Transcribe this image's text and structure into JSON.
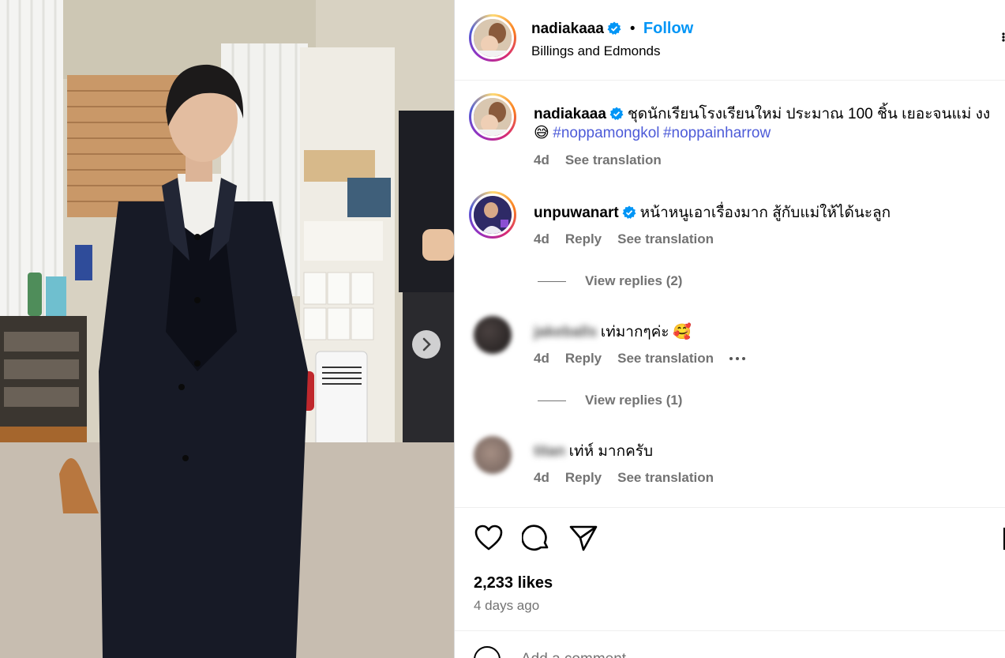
{
  "post": {
    "username": "nadiakaaa",
    "follow_label": "Follow",
    "separator": "•",
    "location": "Billings and Edmonds",
    "caption": {
      "username": "nadiakaaa",
      "text": "ชุดนักเรียนโรงเรียนใหม่ ประมาณ 100 ชิ้น เยอะจนแม่ งง",
      "emoji": "😅",
      "hashtags": [
        "#noppamongkol",
        "#noppainharrow"
      ],
      "age": "4d",
      "see_translation": "See translation"
    },
    "likes": "2,233 likes",
    "posted": "4 days ago",
    "add_comment_placeholder": "Add a comment..."
  },
  "comments": [
    {
      "username": "unpuwanart",
      "verified": true,
      "text": "หน้าหนูเอาเรื่องมาก สู้กับแม่ให้ได้นะลูก",
      "age": "4d",
      "reply": "Reply",
      "see_translation": "See translation",
      "view_replies": "View replies (2)"
    },
    {
      "username": "jakeballs",
      "blurred": true,
      "text": "เท่มากๆค่ะ",
      "emoji": "🥰",
      "age": "4d",
      "reply": "Reply",
      "see_translation": "See translation",
      "view_replies": "View replies (1)"
    },
    {
      "username": "titan",
      "blurred": true,
      "text": "เท่ห์ มากครับ",
      "age": "4d",
      "reply": "Reply",
      "see_translation": "See translation"
    }
  ],
  "colors": {
    "follow": "#0095f6",
    "hashtag": "#4d5bd8",
    "secondary_text": "#737373",
    "verified": "#0095f6"
  },
  "icons": [
    "verified-badge-icon",
    "heart-icon",
    "comment-icon",
    "share-icon",
    "chevron-right-icon",
    "more-icon",
    "emoji-icon"
  ]
}
